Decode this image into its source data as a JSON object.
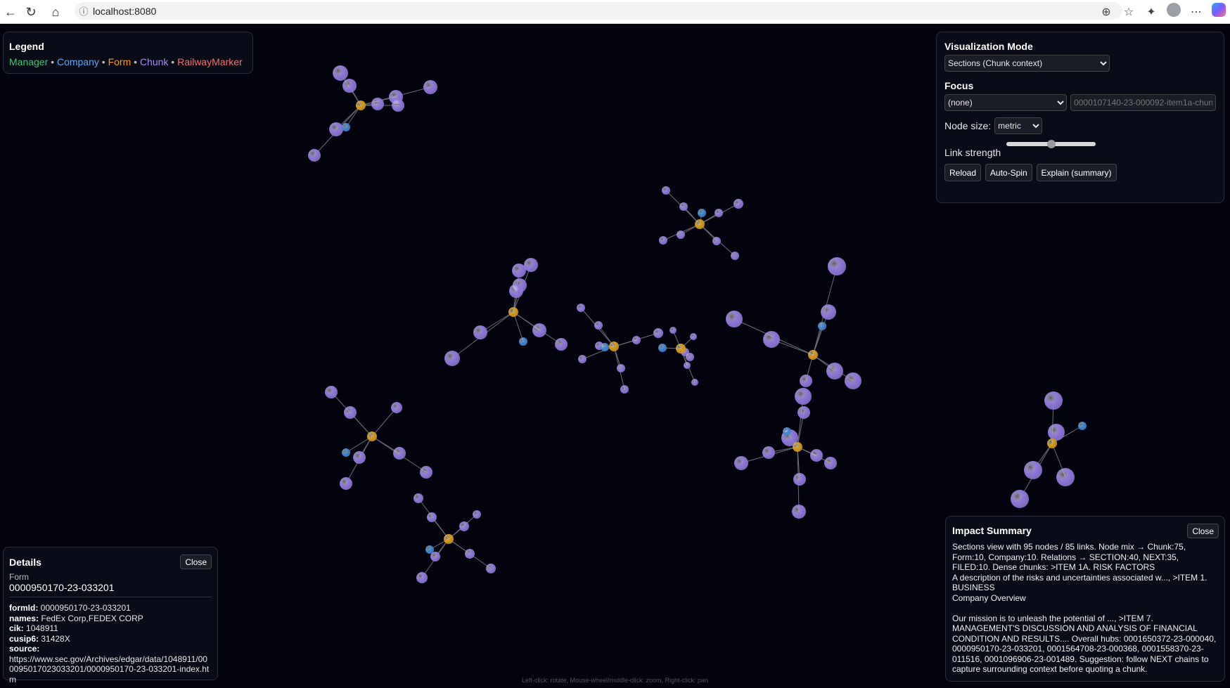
{
  "browser": {
    "url": "localhost:8080"
  },
  "legend": {
    "title": "Legend",
    "items": [
      {
        "label": "Manager",
        "color": "#3cc47c"
      },
      {
        "label": "Company",
        "color": "#5aa8f0"
      },
      {
        "label": "Form",
        "color": "#f0a020"
      },
      {
        "label": "Chunk",
        "color": "#a58cf0"
      },
      {
        "label": "RailwayMarker",
        "color": "#f07070"
      }
    ],
    "separator": "•"
  },
  "controls": {
    "viz_mode_label": "Visualization Mode",
    "viz_mode_value": "Sections (Chunk context)",
    "focus_label": "Focus",
    "focus_value": "(none)",
    "focus_input_placeholder": "0000107140-23-000092-item1a-chun",
    "node_size_label": "Node size:",
    "node_size_value": "metric",
    "link_strength_label": "Link strength",
    "link_strength_value": 50,
    "buttons": {
      "reload": "Reload",
      "auto_spin": "Auto-Spin",
      "explain": "Explain (summary)"
    }
  },
  "details": {
    "title": "Details",
    "close": "Close",
    "type": "Form",
    "id": "0000950170-23-033201",
    "fields": [
      {
        "key": "formId:",
        "value": "0000950170-23-033201"
      },
      {
        "key": "names:",
        "value": "FedEx Corp,FEDEX CORP"
      },
      {
        "key": "cik:",
        "value": "1048911"
      },
      {
        "key": "cusip6:",
        "value": "31428X"
      },
      {
        "key": "source:",
        "value": ""
      }
    ],
    "source_url": "https://www.sec.gov/Archives/edgar/data/1048911/000095017023033201/0000950170-23-033201-index.htm"
  },
  "impact": {
    "title": "Impact Summary",
    "close": "Close",
    "text": "Sections view with 95 nodes / 85 links.  Node mix → Chunk:75, Form:10, Company:10.  Relations → SECTION:40, NEXT:35, FILED:10.  Dense chunks: >ITEM 1A. RISK FACTORS\nA description of the risks and uncertainties associated w..., >ITEM 1. BUSINESS\nCompany Overview\n\nOur mission is to unleash the potential of ..., >ITEM 7. MANAGEMENT'S DISCUSSION AND ANALYSIS OF FINANCIAL CONDITION AND RESULTS.... Overall hubs: 0001650372-23-000040, 0000950170-23-033201, 0001564708-23-000368, 0001558370-23-011516, 0001096906-23-001489.  Suggestion: follow NEXT chains to capture surrounding context before quoting a chunk."
  },
  "hint": "Left-click: rotate, Mouse-wheel/middle-click: zoom, Right-click: pan",
  "graph": {
    "colors": {
      "chunk": "#9079d8",
      "form": "#d49a1a",
      "company": "#3f86cf",
      "link": "#6c6c78"
    },
    "clusters": [
      {
        "form": [
          513,
          150
        ],
        "company": [
          [
            492,
            181
          ]
        ],
        "chunks": [
          [
            484,
            104,
            11
          ],
          [
            497,
            122,
            10
          ],
          [
            537,
            148,
            9
          ],
          [
            563,
            138,
            10
          ],
          [
            566,
            150,
            9
          ],
          [
            612,
            124,
            10
          ],
          [
            478,
            184,
            10
          ],
          [
            447,
            221,
            9
          ]
        ]
      },
      {
        "form": [
          995,
          319
        ],
        "company": [
          [
            998,
            303
          ]
        ],
        "chunks": [
          [
            947,
            271,
            6
          ],
          [
            972,
            294,
            6
          ],
          [
            1022,
            303,
            6
          ],
          [
            1050,
            290,
            7
          ],
          [
            968,
            334,
            6
          ],
          [
            943,
            342,
            6
          ],
          [
            1019,
            343,
            6
          ],
          [
            1045,
            364,
            6
          ]
        ]
      },
      {
        "form": [
          730,
          444
        ],
        "company": [
          [
            744,
            486
          ]
        ],
        "chunks": [
          [
            738,
            385,
            10
          ],
          [
            755,
            377,
            10
          ],
          [
            739,
            406,
            10
          ],
          [
            734,
            414,
            10
          ],
          [
            767,
            470,
            10
          ],
          [
            798,
            490,
            9
          ],
          [
            683,
            473,
            10
          ],
          [
            643,
            510,
            11
          ]
        ]
      },
      {
        "form": [
          873,
          493
        ],
        "company": [
          [
            860,
            494
          ]
        ],
        "chunks": [
          [
            826,
            438,
            6
          ],
          [
            851,
            463,
            6
          ],
          [
            905,
            484,
            6
          ],
          [
            936,
            474,
            7
          ],
          [
            852,
            492,
            6
          ],
          [
            828,
            511,
            6
          ],
          [
            883,
            524,
            6
          ],
          [
            888,
            554,
            6
          ]
        ]
      },
      {
        "form": [
          968,
          496
        ],
        "company": [
          [
            942,
            495
          ]
        ],
        "chunks": [
          [
            957,
            470,
            5
          ],
          [
            986,
            479,
            5
          ],
          [
            974,
            501,
            6
          ],
          [
            981,
            508,
            6
          ],
          [
            977,
            520,
            5
          ],
          [
            988,
            544,
            5
          ]
        ]
      },
      {
        "form": [
          1156,
          505
        ],
        "company": [
          [
            1169,
            464
          ]
        ],
        "chunks": [
          [
            1190,
            379,
            13
          ],
          [
            1178,
            444,
            11
          ],
          [
            1044,
            454,
            12
          ],
          [
            1097,
            483,
            12
          ],
          [
            1187,
            528,
            12
          ],
          [
            1213,
            542,
            12
          ],
          [
            1146,
            542,
            9
          ]
        ]
      },
      {
        "form": [
          1134,
          636
        ],
        "company": [
          [
            1119,
            614
          ]
        ],
        "chunks": [
          [
            1142,
            564,
            12
          ],
          [
            1143,
            587,
            9
          ],
          [
            1123,
            623,
            12
          ],
          [
            1093,
            644,
            9
          ],
          [
            1054,
            659,
            10
          ],
          [
            1161,
            648,
            9
          ],
          [
            1181,
            659,
            9
          ],
          [
            1137,
            682,
            9
          ],
          [
            1136,
            728,
            10
          ]
        ]
      },
      {
        "form": [
          529,
          621
        ],
        "company": [
          [
            492,
            644
          ]
        ],
        "chunks": [
          [
            471,
            558,
            9
          ],
          [
            498,
            587,
            9
          ],
          [
            564,
            580,
            8
          ],
          [
            511,
            651,
            9
          ],
          [
            568,
            645,
            9
          ],
          [
            606,
            672,
            9
          ],
          [
            492,
            688,
            9
          ]
        ]
      },
      {
        "form": [
          638,
          767
        ],
        "company": [
          [
            611,
            782
          ]
        ],
        "chunks": [
          [
            595,
            709,
            7
          ],
          [
            614,
            736,
            7
          ],
          [
            678,
            732,
            6
          ],
          [
            660,
            749,
            7
          ],
          [
            619,
            792,
            7
          ],
          [
            668,
            788,
            7
          ],
          [
            698,
            809,
            7
          ],
          [
            600,
            822,
            8
          ]
        ]
      },
      {
        "form": [
          1496,
          631
        ],
        "company": [
          [
            1539,
            606
          ]
        ],
        "chunks": [
          [
            1498,
            570,
            13
          ],
          [
            1502,
            615,
            12
          ],
          [
            1469,
            669,
            13
          ],
          [
            1515,
            679,
            13
          ],
          [
            1450,
            710,
            13
          ]
        ]
      }
    ]
  }
}
